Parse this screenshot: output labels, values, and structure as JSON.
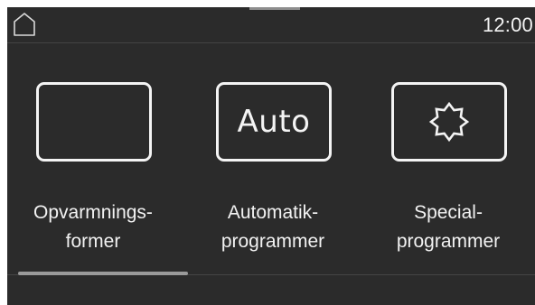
{
  "status_bar": {
    "home_icon": "home-icon",
    "clock": "12:00"
  },
  "menu": {
    "items": [
      {
        "icon": "empty-frame-icon",
        "icon_text": "",
        "label_line1": "Opvarmnings-",
        "label_line2": "former"
      },
      {
        "icon": "auto-icon",
        "icon_text": "Auto",
        "label_line1": "Automatik-",
        "label_line2": "programmer"
      },
      {
        "icon": "star-burst-icon",
        "icon_text": "",
        "label_line1": "Special-",
        "label_line2": "programmer"
      }
    ]
  },
  "colors": {
    "background": "#2b2b2b",
    "foreground": "#f4f4f4",
    "divider": "#444444",
    "indicator": "#9a9a9a"
  }
}
